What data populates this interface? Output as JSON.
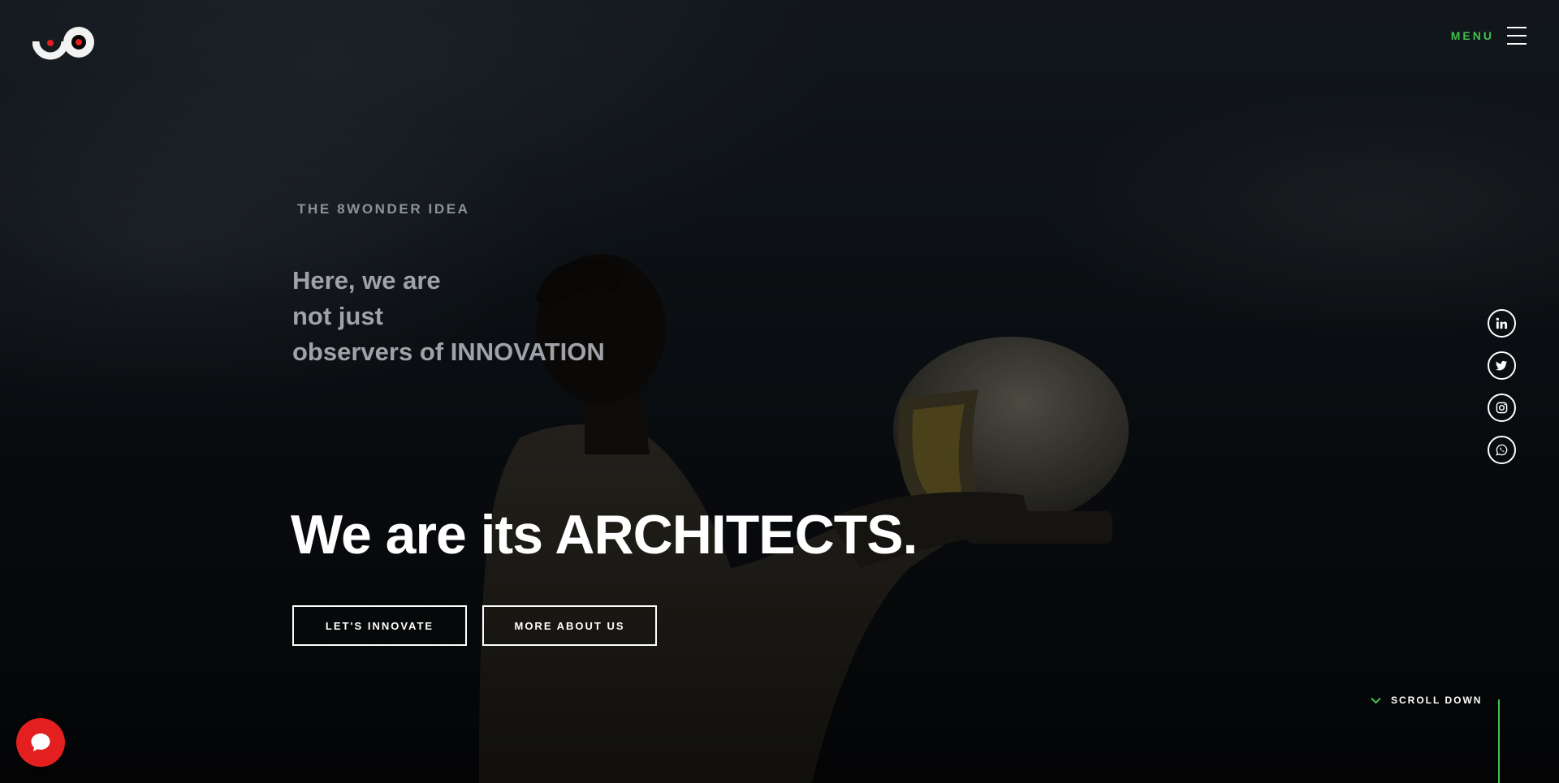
{
  "header": {
    "menu_label": "MENU",
    "logo_icon": "8wonder-logo-icon",
    "menu_icon": "hamburger-icon"
  },
  "hero": {
    "eyebrow": "THE 8WONDER IDEA",
    "lead_lines": [
      "Here, we are",
      "not just",
      "observers of INNOVATION"
    ],
    "headline": "We are its ARCHITECTS.",
    "buttons": {
      "innovate": "LET'S INNOVATE",
      "about": "MORE ABOUT US"
    }
  },
  "socials": [
    {
      "icon": "linkedin-icon"
    },
    {
      "icon": "twitter-icon"
    },
    {
      "icon": "instagram-icon"
    },
    {
      "icon": "whatsapp-icon"
    }
  ],
  "scroll": {
    "label": "SCROLL DOWN",
    "icon": "chevron-down-icon"
  },
  "chat": {
    "icon": "chat-bubble-icon"
  },
  "colors": {
    "accent": "#3fc24a",
    "chat": "#e3201f",
    "logo_dot": "#e3201f"
  }
}
